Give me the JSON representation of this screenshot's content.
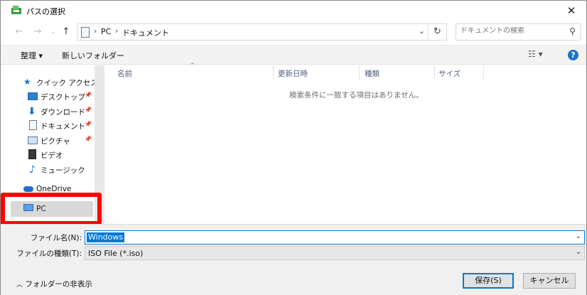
{
  "window": {
    "title": "パスの選択"
  },
  "address": {
    "crumbs": [
      "PC",
      "ドキュメント"
    ],
    "search_placeholder": "ドキュメントの検索"
  },
  "toolbar": {
    "organize_label": "整理 ▾",
    "new_folder_label": "新しいフォルダー"
  },
  "sidebar": {
    "items": [
      {
        "label": "クイック アクセス",
        "icon": "star-icon",
        "pinned": false
      },
      {
        "label": "デスクトップ",
        "icon": "desktop-icon",
        "pinned": true
      },
      {
        "label": "ダウンロード",
        "icon": "download-icon",
        "pinned": true
      },
      {
        "label": "ドキュメント",
        "icon": "document-icon",
        "pinned": true
      },
      {
        "label": "ピクチャ",
        "icon": "picture-icon",
        "pinned": true
      },
      {
        "label": "ビデオ",
        "icon": "video-icon",
        "pinned": false
      },
      {
        "label": "ミュージック",
        "icon": "music-icon",
        "pinned": false
      },
      {
        "label": "OneDrive",
        "icon": "cloud-icon",
        "pinned": false
      },
      {
        "label": "PC",
        "icon": "pc-icon",
        "pinned": false,
        "selected": true
      }
    ]
  },
  "content": {
    "columns": [
      "名前",
      "更新日時",
      "種類",
      "サイズ"
    ],
    "empty_message": "検索条件に一致する項目はありません。"
  },
  "bottom": {
    "filename_label": "ファイル名(N):",
    "filename_value": "Windows",
    "filetype_label": "ファイルの種類(T):",
    "filetype_value": "ISO File (*.iso)",
    "hide_folders_label": "フォルダーの非表示",
    "save_label": "保存(S)",
    "cancel_label": "キャンセル"
  },
  "colors": {
    "accent": "#0078d7",
    "highlight_border": "#ff0000"
  }
}
